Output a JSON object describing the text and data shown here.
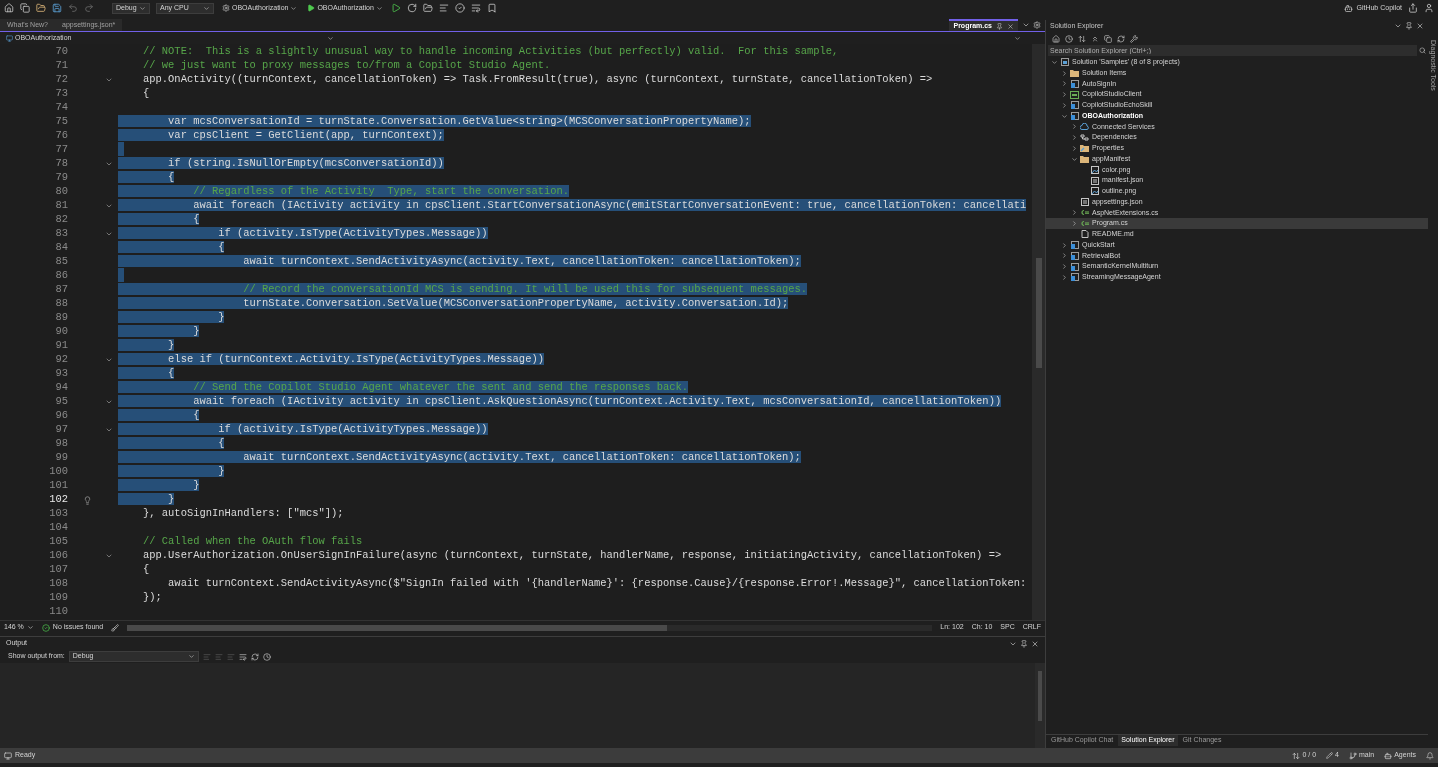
{
  "toolbar": {
    "config": "Debug",
    "platform": "Any CPU",
    "startup_project": "OBOAuthorization",
    "run_target": "OBOAuthorization",
    "copilot": "GitHub Copilot"
  },
  "doc_tabs": [
    {
      "label": "What's New?",
      "selected": false
    },
    {
      "label": "appsettings.json*",
      "selected": false
    }
  ],
  "active_tab": {
    "label": "Program.cs",
    "selected": true
  },
  "nav_bar": {
    "project": "OBOAuthorization"
  },
  "editor": {
    "lines": [
      {
        "n": "70",
        "fold": false,
        "selected": false,
        "current": false,
        "kind": "comment",
        "text": "    // NOTE:  This is a slightly unusual way to handle incoming Activities (but perfectly) valid.  For this sample,"
      },
      {
        "n": "71",
        "fold": false,
        "selected": false,
        "current": false,
        "kind": "comment",
        "text": "    // we just want to proxy messages to/from a Copilot Studio Agent."
      },
      {
        "n": "72",
        "fold": true,
        "selected": false,
        "current": false,
        "kind": "code",
        "text": "    app.OnActivity((turnContext, cancellationToken) => Task.FromResult(true), async (turnContext, turnState, cancellationToken) =>"
      },
      {
        "n": "73",
        "fold": false,
        "selected": false,
        "current": false,
        "kind": "code",
        "text": "    {"
      },
      {
        "n": "74",
        "fold": false,
        "selected": false,
        "current": false
      },
      {
        "n": "75",
        "fold": false,
        "selected": true,
        "current": false,
        "kind": "code",
        "text": "        var mcsConversationId = turnState.Conversation.GetValue<string>(MCSConversationPropertyName);"
      },
      {
        "n": "76",
        "fold": false,
        "selected": true,
        "current": false,
        "kind": "code",
        "text": "        var cpsClient = GetClient(app, turnContext);"
      },
      {
        "n": "77",
        "fold": false,
        "selected": true,
        "current": false
      },
      {
        "n": "78",
        "fold": true,
        "selected": true,
        "current": false,
        "kind": "code",
        "text": "        if (string.IsNullOrEmpty(mcsConversationId))"
      },
      {
        "n": "79",
        "fold": false,
        "selected": true,
        "current": false,
        "kind": "code",
        "text": "        {"
      },
      {
        "n": "80",
        "fold": false,
        "selected": true,
        "current": false,
        "kind": "comment",
        "text": "            // Regardless of the Activity  Type, start the conversation."
      },
      {
        "n": "81",
        "fold": true,
        "selected": true,
        "current": false,
        "kind": "code",
        "text": "            await foreach (IActivity activity in cpsClient.StartConversationAsync(emitStartConversationEvent: true, cancellationToken: cancellati"
      },
      {
        "n": "82",
        "fold": false,
        "selected": true,
        "current": false,
        "kind": "code",
        "text": "            {"
      },
      {
        "n": "83",
        "fold": true,
        "selected": true,
        "current": false,
        "kind": "code",
        "text": "                if (activity.IsType(ActivityTypes.Message))"
      },
      {
        "n": "84",
        "fold": false,
        "selected": true,
        "current": false,
        "kind": "code",
        "text": "                {"
      },
      {
        "n": "85",
        "fold": false,
        "selected": true,
        "current": false,
        "kind": "code",
        "text": "                    await turnContext.SendActivityAsync(activity.Text, cancellationToken: cancellationToken);"
      },
      {
        "n": "86",
        "fold": false,
        "selected": true,
        "current": false
      },
      {
        "n": "87",
        "fold": false,
        "selected": true,
        "current": false,
        "kind": "comment",
        "text": "                    // Record the conversationId MCS is sending. It will be used this for subsequent messages."
      },
      {
        "n": "88",
        "fold": false,
        "selected": true,
        "current": false,
        "kind": "code",
        "text": "                    turnState.Conversation.SetValue(MCSConversationPropertyName, activity.Conversation.Id);"
      },
      {
        "n": "89",
        "fold": false,
        "selected": true,
        "current": false,
        "kind": "code",
        "text": "                }"
      },
      {
        "n": "90",
        "fold": false,
        "selected": true,
        "current": false,
        "kind": "code",
        "text": "            }"
      },
      {
        "n": "91",
        "fold": false,
        "selected": true,
        "current": false,
        "kind": "code",
        "text": "        }"
      },
      {
        "n": "92",
        "fold": true,
        "selected": true,
        "current": false,
        "kind": "code",
        "text": "        else if (turnContext.Activity.IsType(ActivityTypes.Message))"
      },
      {
        "n": "93",
        "fold": false,
        "selected": true,
        "current": false,
        "kind": "code",
        "text": "        {"
      },
      {
        "n": "94",
        "fold": false,
        "selected": true,
        "current": false,
        "kind": "comment",
        "text": "            // Send the Copilot Studio Agent whatever the sent and send the responses back."
      },
      {
        "n": "95",
        "fold": true,
        "selected": true,
        "current": false,
        "kind": "code",
        "text": "            await foreach (IActivity activity in cpsClient.AskQuestionAsync(turnContext.Activity.Text, mcsConversationId, cancellationToken))"
      },
      {
        "n": "96",
        "fold": false,
        "selected": true,
        "current": false,
        "kind": "code",
        "text": "            {"
      },
      {
        "n": "97",
        "fold": true,
        "selected": true,
        "current": false,
        "kind": "code",
        "text": "                if (activity.IsType(ActivityTypes.Message))"
      },
      {
        "n": "98",
        "fold": false,
        "selected": true,
        "current": false,
        "kind": "code",
        "text": "                {"
      },
      {
        "n": "99",
        "fold": false,
        "selected": true,
        "current": false,
        "kind": "code",
        "text": "                    await turnContext.SendActivityAsync(activity.Text, cancellationToken: cancellationToken);"
      },
      {
        "n": "100",
        "fold": false,
        "selected": true,
        "current": false,
        "kind": "code",
        "text": "                }"
      },
      {
        "n": "101",
        "fold": false,
        "selected": true,
        "current": false,
        "kind": "code",
        "text": "            }"
      },
      {
        "n": "102",
        "fold": false,
        "selected": true,
        "current": true,
        "lightbulb": true,
        "kind": "code",
        "text": "        }"
      },
      {
        "n": "103",
        "fold": false,
        "selected": false,
        "current": false,
        "kind": "code",
        "text": "    }, autoSignInHandlers: [\"mcs\"]);"
      },
      {
        "n": "104",
        "fold": false,
        "selected": false,
        "current": false
      },
      {
        "n": "105",
        "fold": false,
        "selected": false,
        "current": false,
        "kind": "comment",
        "text": "    // Called when the OAuth flow fails"
      },
      {
        "n": "106",
        "fold": true,
        "selected": false,
        "current": false,
        "kind": "code",
        "text": "    app.UserAuthorization.OnUserSignInFailure(async (turnContext, turnState, handlerName, response, initiatingActivity, cancellationToken) =>"
      },
      {
        "n": "107",
        "fold": false,
        "selected": false,
        "current": false,
        "kind": "code",
        "text": "    {"
      },
      {
        "n": "108",
        "fold": false,
        "selected": false,
        "current": false,
        "kind": "code",
        "text": "        await turnContext.SendActivityAsync($\"SignIn failed with '{handlerName}': {response.Cause}/{response.Error!.Message}\", cancellationToken:"
      },
      {
        "n": "109",
        "fold": false,
        "selected": false,
        "current": false,
        "kind": "code",
        "text": "    });"
      },
      {
        "n": "110",
        "fold": false,
        "selected": false,
        "current": false
      }
    ]
  },
  "editor_status": {
    "zoom": "146 %",
    "issues": "No issues found",
    "line": "Ln: 102",
    "column": "Ch: 10",
    "whitespace": "SPC",
    "line_ending": "CRLF"
  },
  "output": {
    "title": "Output",
    "source_label": "Show output from:",
    "source": "Debug"
  },
  "solution_explorer": {
    "title": "Solution Explorer",
    "search": {
      "placeholder": "Search Solution Explorer (Ctrl+;)"
    },
    "tree": [
      {
        "label": "Solution 'Samples' (8 of 8 projects)",
        "kind": "solution",
        "expanded": true,
        "selected": false,
        "children": [
          {
            "label": "Solution Items",
            "kind": "folder",
            "expanded": false,
            "selected": false
          },
          {
            "label": "AutoSignIn",
            "kind": "project",
            "expanded": false,
            "selected": false
          },
          {
            "label": "CopilotStudioClient",
            "kind": "csproject",
            "expanded": false,
            "selected": false
          },
          {
            "label": "CopilotStudioEchoSkill",
            "kind": "project",
            "expanded": false,
            "selected": false
          },
          {
            "label": "OBOAuthorization",
            "kind": "project",
            "expanded": true,
            "selected": false,
            "startup": true,
            "children": [
              {
                "label": "Connected Services",
                "kind": "services",
                "expanded": false,
                "selected": false
              },
              {
                "label": "Dependencies",
                "kind": "deps",
                "expanded": false,
                "selected": false
              },
              {
                "label": "Properties",
                "kind": "props",
                "expanded": false,
                "selected": false
              },
              {
                "label": "appManifest",
                "kind": "folder",
                "expanded": true,
                "selected": false,
                "children": [
                  {
                    "label": "color.png",
                    "kind": "image",
                    "selected": false
                  },
                  {
                    "label": "manifest.json",
                    "kind": "json",
                    "selected": false
                  },
                  {
                    "label": "outline.png",
                    "kind": "image",
                    "selected": false
                  }
                ]
              },
              {
                "label": "appsettings.json",
                "kind": "json",
                "selected": false
              },
              {
                "label": "AspNetExtensions.cs",
                "kind": "cs",
                "expanded": false,
                "selected": false
              },
              {
                "label": "Program.cs",
                "kind": "cs",
                "expanded": false,
                "selected": true
              },
              {
                "label": "README.md",
                "kind": "md",
                "selected": false
              }
            ]
          },
          {
            "label": "QuickStart",
            "kind": "project",
            "expanded": false,
            "selected": false
          },
          {
            "label": "RetrievalBot",
            "kind": "project",
            "expanded": false,
            "selected": false
          },
          {
            "label": "SemanticKernelMultiturn",
            "kind": "project",
            "expanded": false,
            "selected": false
          },
          {
            "label": "StreamingMessageAgent",
            "kind": "project",
            "expanded": false,
            "selected": false
          }
        ]
      }
    ],
    "bottom_tabs": [
      {
        "label": "GitHub Copilot Chat",
        "selected": false
      },
      {
        "label": "Solution Explorer",
        "selected": true
      },
      {
        "label": "Git Changes",
        "selected": false
      }
    ]
  },
  "side_strip": {
    "label": "Diagnostic Tools"
  },
  "status_bar": {
    "state": "Ready",
    "sync": "0 / 0",
    "edits": "4",
    "branch": "main",
    "agents": "Agents"
  }
}
